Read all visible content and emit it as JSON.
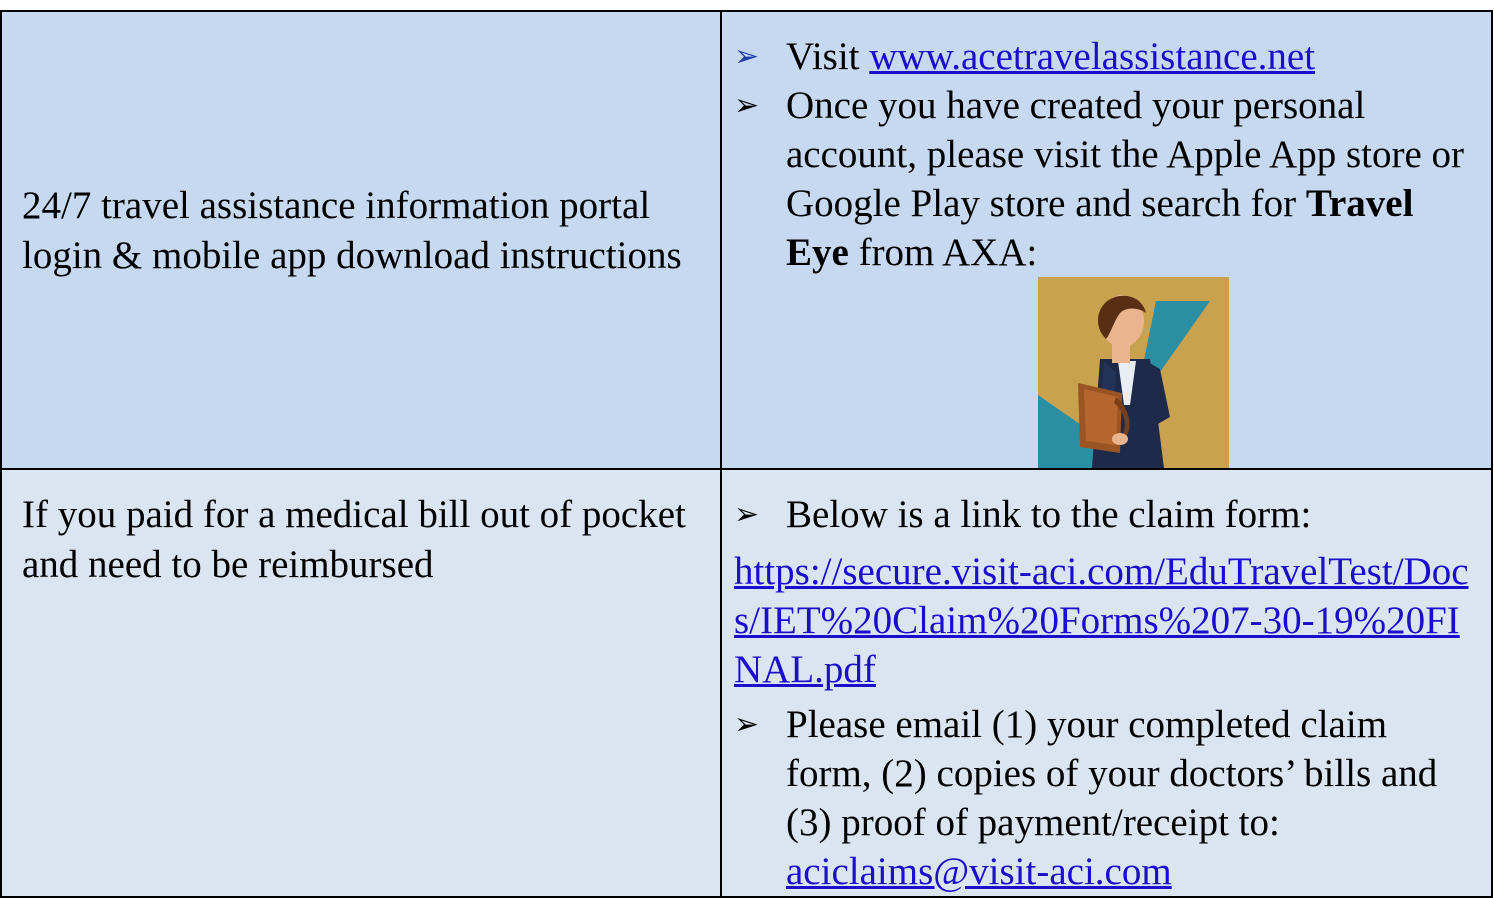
{
  "rows": [
    {
      "label": "24/7 travel assistance information portal login & mobile app download instructions",
      "bullet_visit_prefix": "Visit ",
      "bullet_visit_link": "www.acetravelassistance.net",
      "bullet_account_text": "Once you have created your personal account, please visit the Apple App store or Google Play store and search for ",
      "bullet_account_bold": "Travel Eye",
      "bullet_account_suffix": " from AXA:",
      "app_icon": "travel-eye-app-icon"
    },
    {
      "label": "If you paid for a medical bill out of pocket and need to be reimbursed",
      "bullet_link_intro": "Below is a link to the claim form:",
      "claim_form_link": "https://secure.visit-aci.com/EduTravelTest/Docs/IET%20Claim%20Forms%207-30-19%20FINAL.pdf",
      "bullet_email_text": "Please email (1) your completed claim form, (2) copies of your doctors’ bills and (3) proof of payment/receipt to:",
      "email_link": "aciclaims@visit-aci.com"
    }
  ],
  "colors": {
    "row1_background": "#c6d9f1",
    "row2_background": "#dbe5f1",
    "link": "#1a0dcc",
    "blue_arrow": "#1f3ea8"
  }
}
